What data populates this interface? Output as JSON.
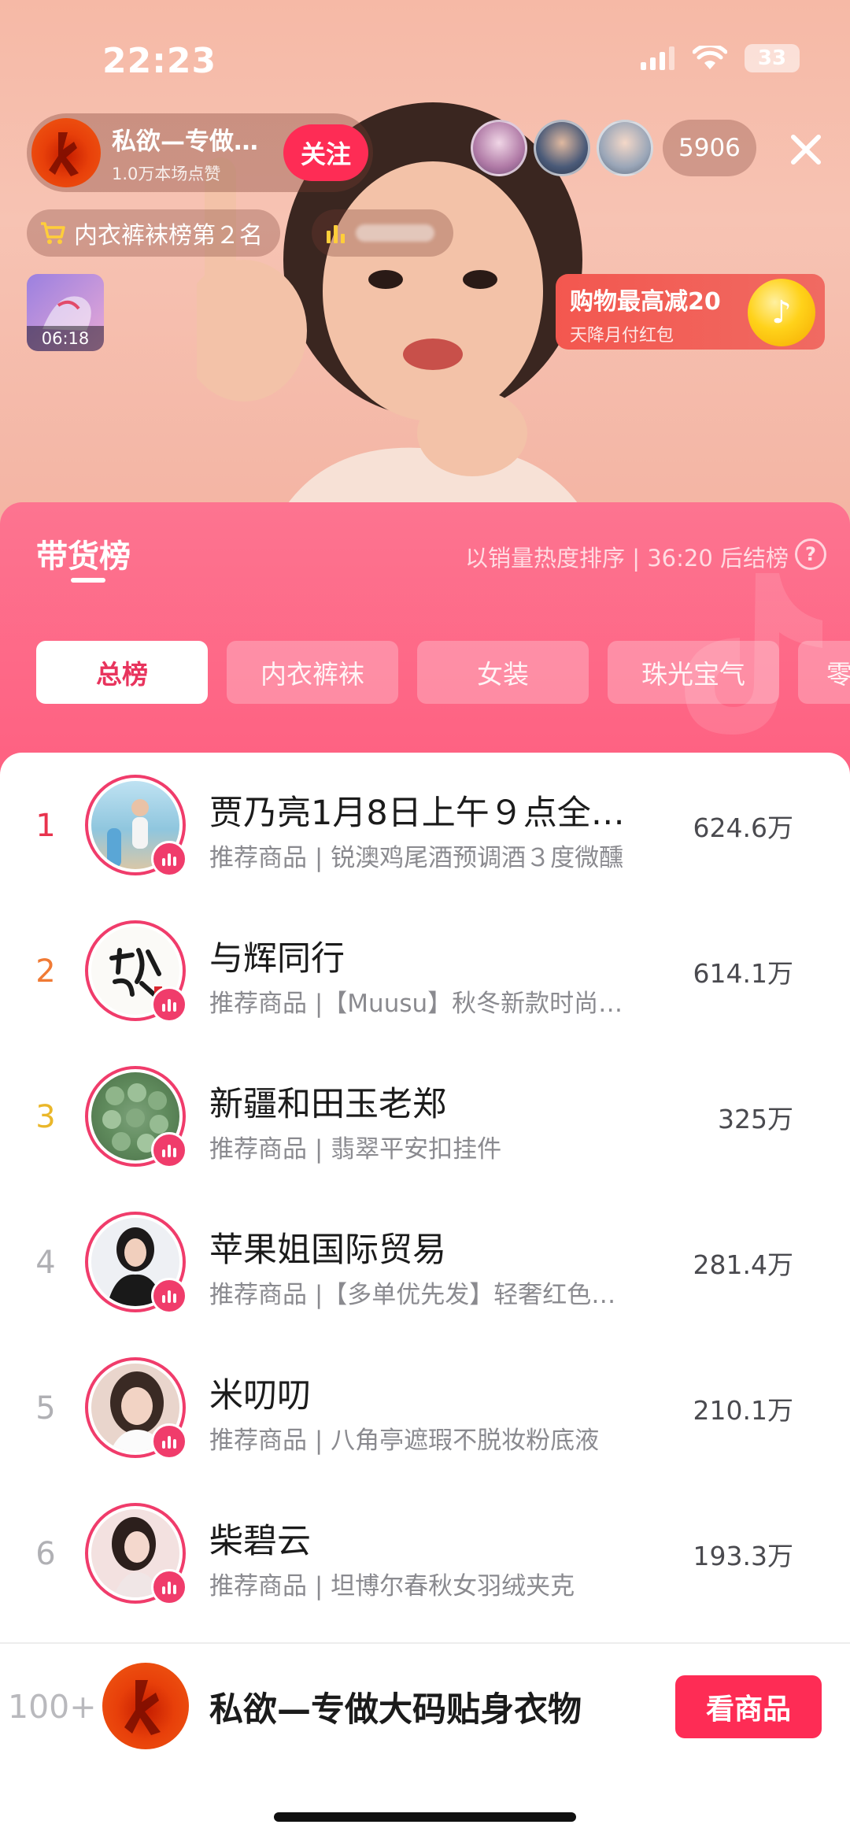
{
  "status_bar": {
    "time": "22:23",
    "battery": "33"
  },
  "live": {
    "anchor_name": "私欲—专做…",
    "anchor_likes": "1.0万本场点赞",
    "follow_label": "关注",
    "viewer_count": "5906",
    "rank_chip": "内衣裤袜榜第２名",
    "replay_time": "06:18",
    "coupon_title": "购物最高减20",
    "coupon_sub": "天降月付红包"
  },
  "panel": {
    "title": "带货榜",
    "meta": "以销量热度排序 | 36:20 后结榜",
    "help": "?",
    "tabs": [
      "总榜",
      "内衣裤袜",
      "女装",
      "珠光宝气",
      "零"
    ]
  },
  "ranking": [
    {
      "rank": "1",
      "title": "贾乃亮1月8日上午９点全…",
      "subtitle": "推荐商品 | 锐澳鸡尾酒预调酒３度微醺",
      "value": "624.6万"
    },
    {
      "rank": "2",
      "title": "与辉同行",
      "subtitle": "推荐商品 |【Muusu】秋冬新款时尚…",
      "value": "614.1万"
    },
    {
      "rank": "3",
      "title": "新疆和田玉老郑",
      "subtitle": "推荐商品 | 翡翠平安扣挂件",
      "value": "325万"
    },
    {
      "rank": "4",
      "title": "苹果姐国际贸易",
      "subtitle": "推荐商品 |【多单优先发】轻奢红色…",
      "value": "281.4万"
    },
    {
      "rank": "5",
      "title": "米叨叨",
      "subtitle": "推荐商品 | 八角亭遮瑕不脱妆粉底液",
      "value": "210.1万"
    },
    {
      "rank": "6",
      "title": "柴碧云",
      "subtitle": "推荐商品 | 坦博尔春秋女羽绒夹克",
      "value": "193.3万"
    }
  ],
  "own": {
    "rank": "100+",
    "name": "私欲—专做大码贴身衣物",
    "button": "看商品"
  },
  "colors": {
    "accent": "#fe2c55",
    "rank1": "#e8334d",
    "rank2": "#f07a34",
    "rank3": "#eab72a"
  }
}
